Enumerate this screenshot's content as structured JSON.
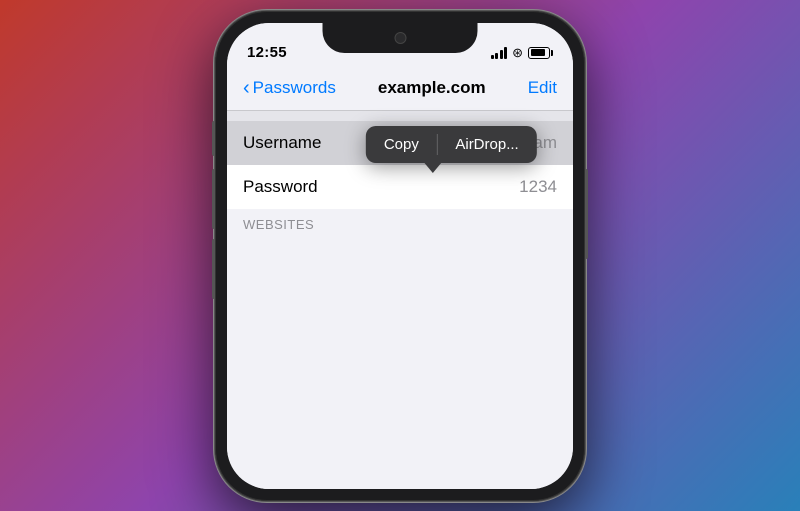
{
  "phone": {
    "status_bar": {
      "time": "12:55",
      "battery_percent": 85
    },
    "nav_bar": {
      "back_label": "Passwords",
      "title": "example.com",
      "edit_label": "Edit"
    },
    "rows": [
      {
        "id": "username",
        "label": "Username",
        "value": "shivam"
      },
      {
        "id": "password",
        "label": "Password",
        "value": "1234"
      }
    ],
    "popup_menu": {
      "copy_label": "Copy",
      "airdrop_label": "AirDrop..."
    },
    "websites_label": "WEBSITES"
  }
}
